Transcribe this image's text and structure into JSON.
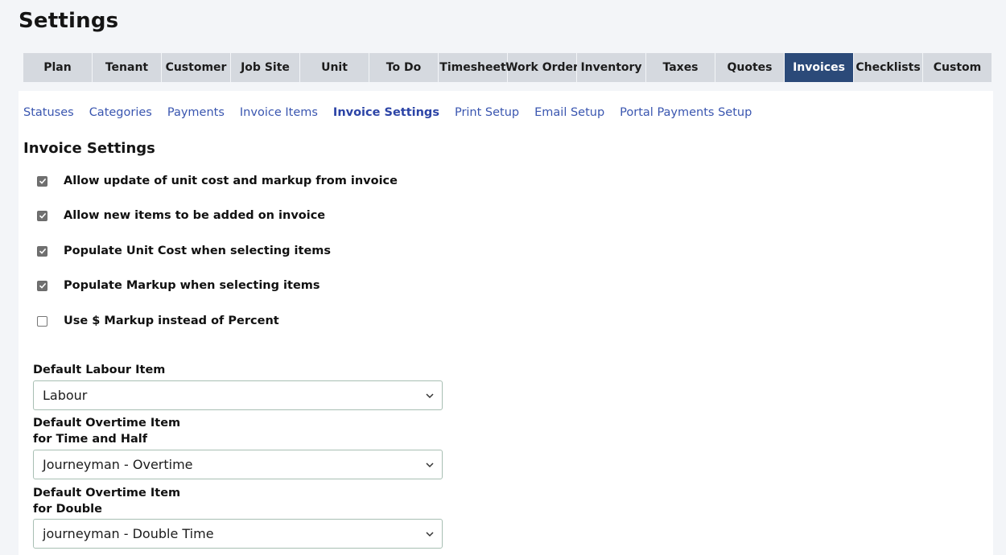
{
  "header": {
    "title": "Settings"
  },
  "main_tabs": [
    {
      "label": "Plan",
      "width": 85
    },
    {
      "label": "Tenant",
      "width": 85
    },
    {
      "label": "Customer",
      "width": 85
    },
    {
      "label": "Job Site",
      "width": 85
    },
    {
      "label": "Unit",
      "width": 85
    },
    {
      "label": "To Do",
      "width": 85
    },
    {
      "label": "Timesheet",
      "width": 85
    },
    {
      "label": "Work Order",
      "width": 85
    },
    {
      "label": "Inventory",
      "width": 85
    },
    {
      "label": "Taxes",
      "width": 85
    },
    {
      "label": "Quotes",
      "width": 85
    },
    {
      "label": "Invoices",
      "width": 85
    },
    {
      "label": "Checklists",
      "width": 85
    },
    {
      "label": "Custom",
      "width": 85
    }
  ],
  "active_main_tab": "Invoices",
  "sub_tabs": [
    {
      "label": "Statuses"
    },
    {
      "label": "Categories"
    },
    {
      "label": "Payments"
    },
    {
      "label": "Invoice Items"
    },
    {
      "label": "Invoice Settings"
    },
    {
      "label": "Print Setup"
    },
    {
      "label": "Email Setup"
    },
    {
      "label": "Portal Payments Setup"
    }
  ],
  "active_sub_tab": "Invoice Settings",
  "section": {
    "title": "Invoice Settings"
  },
  "options": [
    {
      "label": "Allow update of unit cost and markup from invoice",
      "checked": true
    },
    {
      "label": "Allow new items to be added on invoice",
      "checked": true
    },
    {
      "label": "Populate Unit Cost when selecting items",
      "checked": true
    },
    {
      "label": "Populate Markup when selecting items",
      "checked": true
    },
    {
      "label": "Use $ Markup instead of Percent",
      "checked": false
    }
  ],
  "fields": {
    "labour": {
      "label": "Default Labour Item",
      "value": "Labour"
    },
    "overtime_half": {
      "label_line1": "Default Overtime Item",
      "label_line2": "for Time and Half",
      "value": "Journeyman - Overtime"
    },
    "overtime_double": {
      "label_line1": "Default Overtime Item",
      "label_line2": "for Double",
      "value": "journeyman - Double Time"
    }
  },
  "colors": {
    "active_tab_bg": "#2b4a79",
    "tab_bg": "#d5d9df",
    "link": "#3a56b0",
    "page_bg": "#f3f5f8"
  }
}
